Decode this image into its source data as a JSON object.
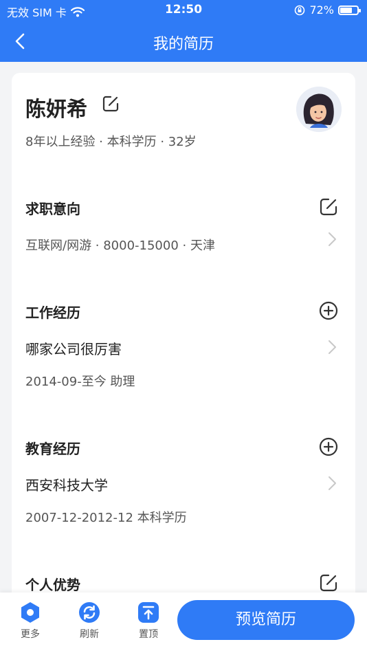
{
  "status_bar": {
    "carrier": "无效 SIM 卡",
    "time": "12:50",
    "battery": "72%",
    "battery_level": 0.72
  },
  "nav": {
    "title": "我的简历"
  },
  "profile": {
    "name": "陈妍希",
    "meta": "8年以上经验 · 本科学历 · 32岁"
  },
  "sections": {
    "job_intent": {
      "title": "求职意向",
      "summary": "互联网/网游 · 8000-15000 · 天津"
    },
    "work": {
      "title": "工作经历",
      "company": "哪家公司很厉害",
      "detail": "2014-09-至今  助理"
    },
    "education": {
      "title": "教育经历",
      "school": "西安科技大学",
      "detail": "2007-12-2012-12  本科学历"
    },
    "advantages": {
      "title": "个人优势"
    }
  },
  "bottom_bar": {
    "more": "更多",
    "refresh": "刷新",
    "top": "置顶",
    "preview": "预览简历"
  },
  "colors": {
    "accent": "#2f7bf6",
    "background": "#f3f4f6"
  }
}
